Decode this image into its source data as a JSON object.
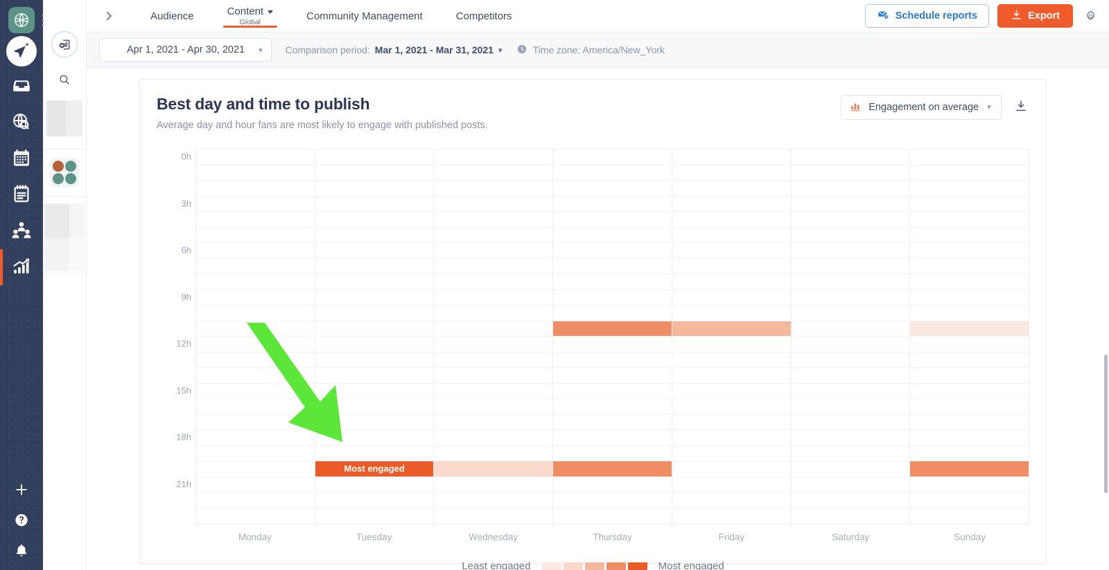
{
  "rail": {
    "logo": "brand-logo-icon",
    "items": [
      {
        "name": "publish",
        "icon": "paper-plane-icon",
        "active": false
      },
      {
        "name": "inbox",
        "icon": "inbox-tray-icon",
        "active": false
      },
      {
        "name": "listening",
        "icon": "globe-search-icon",
        "active": false
      },
      {
        "name": "calendar",
        "icon": "calendar-icon",
        "active": false
      },
      {
        "name": "notes",
        "icon": "notepad-icon",
        "active": false
      },
      {
        "name": "community",
        "icon": "people-group-icon",
        "active": false
      },
      {
        "name": "analytics",
        "icon": "bar-chart-up-icon",
        "active": true
      }
    ],
    "bottom": [
      {
        "name": "create",
        "icon": "plus-icon"
      },
      {
        "name": "help",
        "icon": "question-circle-icon"
      },
      {
        "name": "notifications",
        "icon": "bell-icon"
      }
    ]
  },
  "panel": {
    "add_report_icon": "add-report-icon",
    "search_icon": "search-icon",
    "profile_grid_icon": "profile-group-icon"
  },
  "topnav": {
    "expand_icon": "chevron-right-icon",
    "tabs": [
      {
        "label": "Audience",
        "sublabel": "",
        "caret": false,
        "active": false
      },
      {
        "label": "Content",
        "sublabel": "Global",
        "caret": true,
        "active": true
      },
      {
        "label": "Community Management",
        "sublabel": "",
        "caret": false,
        "active": false
      },
      {
        "label": "Competitors",
        "sublabel": "",
        "caret": false,
        "active": false
      }
    ],
    "schedule_reports_label": "Schedule reports",
    "schedule_reports_icon": "mail-schedule-icon",
    "export_label": "Export",
    "export_icon": "download-icon",
    "settings_icon": "gear-icon",
    "accent_blue": "#2878d5",
    "accent_orange": "#ef5b2b"
  },
  "filterbar": {
    "calendar_icon": "calendar-icon",
    "date_range": "Apr 1, 2021 - Apr 30, 2021",
    "comparison_label": "Comparison period:",
    "comparison_value": "Mar 1, 2021 - Mar 31, 2021",
    "clock_icon": "clock-icon",
    "timezone": "Time zone: America/New_York"
  },
  "card": {
    "title": "Best day and time to publish",
    "subtitle": "Average day and hour fans are most likely to engage with published posts.",
    "metric_icon": "bar-chart-icon",
    "metric_label": "Engagement on average",
    "download_icon": "download-icon",
    "callout_label": "Most engaged",
    "annotation_arrow": "green-arrow-pointing-down-right"
  },
  "chart_data": {
    "type": "heatmap",
    "title": "Best day and time to publish",
    "subtitle": "Average day and hour fans are most likely to engage with published posts.",
    "xlabel": "",
    "ylabel": "",
    "grid": true,
    "legend_position": "bottom-center",
    "categories": [
      "Monday",
      "Tuesday",
      "Wednesday",
      "Thursday",
      "Friday",
      "Saturday",
      "Sunday"
    ],
    "hours": [
      0,
      1,
      2,
      3,
      4,
      5,
      6,
      7,
      8,
      9,
      10,
      11,
      12,
      13,
      14,
      15,
      16,
      17,
      18,
      19,
      20,
      21,
      22,
      23
    ],
    "y_tick_labels": [
      "0h",
      "3h",
      "6h",
      "9h",
      "12h",
      "15h",
      "18h",
      "21h"
    ],
    "y_tick_hours": [
      0,
      3,
      6,
      9,
      12,
      15,
      18,
      21
    ],
    "intensity_levels": [
      0,
      1,
      2,
      3,
      4,
      5
    ],
    "level_colors": [
      "#ffffff",
      "#fbe9e1",
      "#f9d9cb",
      "#f4b89d",
      "#ef8e64",
      "#ea5b27"
    ],
    "legend": {
      "min_label": "Least engaged",
      "max_label": "Most engaged",
      "swatches": [
        "#fbe9e1",
        "#f9d9cb",
        "#f4b89d",
        "#ef8e64",
        "#ea5b27"
      ]
    },
    "cells": [
      {
        "day": "Thursday",
        "hour": 11,
        "level": 4
      },
      {
        "day": "Friday",
        "hour": 11,
        "level": 3
      },
      {
        "day": "Sunday",
        "hour": 11,
        "level": 1
      },
      {
        "day": "Tuesday",
        "hour": 20,
        "level": 5,
        "label": "Most engaged"
      },
      {
        "day": "Wednesday",
        "hour": 20,
        "level": 2
      },
      {
        "day": "Thursday",
        "hour": 20,
        "level": 4
      },
      {
        "day": "Sunday",
        "hour": 20,
        "level": 4
      }
    ]
  }
}
